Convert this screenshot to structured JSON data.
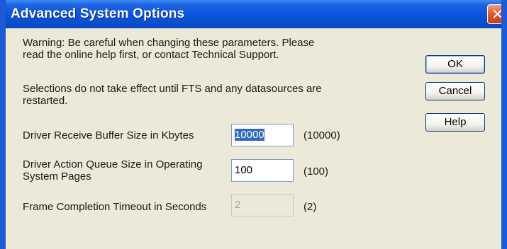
{
  "window": {
    "title": "Advanced System Options",
    "close_symbol": "✕"
  },
  "messages": {
    "warning_line1": "Warning: Be careful when changing these parameters. Please",
    "warning_line2": "read the online help first, or contact Technical Support.",
    "restart_line1": "Selections do not take effect until FTS and any datasources are",
    "restart_line2": "restarted."
  },
  "buttons": {
    "ok": "OK",
    "cancel": "Cancel",
    "help": "Help"
  },
  "settings": {
    "receive_buffer": {
      "label": "Driver Receive Buffer Size in Kbytes",
      "value": "10000",
      "default": "(10000)"
    },
    "action_queue": {
      "label_line1": "Driver Action Queue Size in Operating",
      "label_line2": "System Pages",
      "value": "100",
      "default": "(100)"
    },
    "frame_timeout": {
      "label": "Frame Completion Timeout in Seconds",
      "value": "2",
      "default": "(2)"
    }
  },
  "icons": {
    "close": "close-icon"
  },
  "colors": {
    "titlebar": "#0a55de",
    "dialog_background": "#ece9d8",
    "close_button": "#e35f3a",
    "selection": "#316ac5"
  }
}
